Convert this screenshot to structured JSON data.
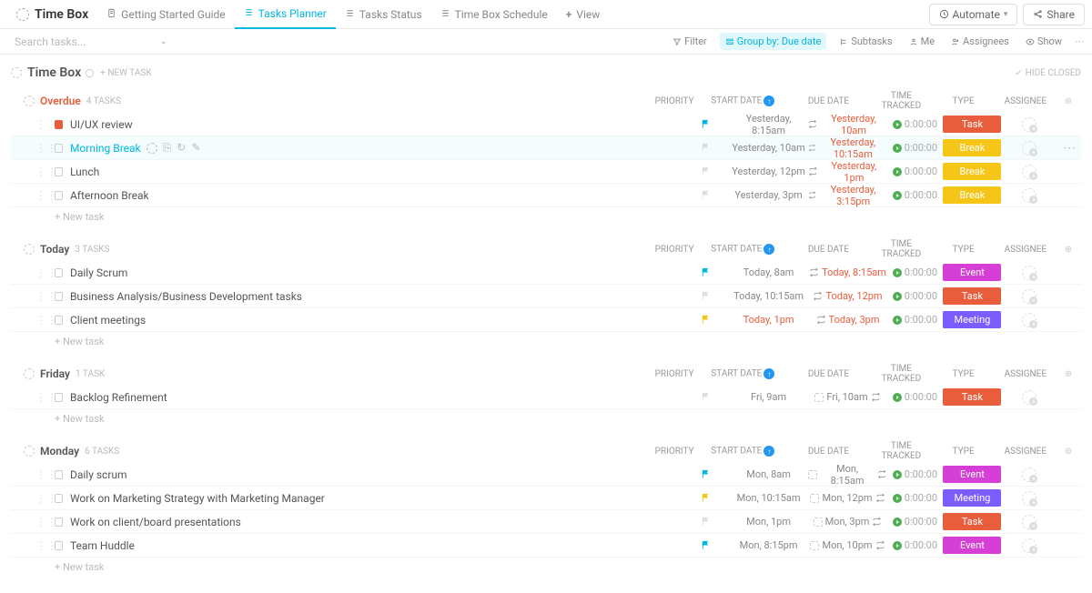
{
  "header": {
    "space_title": "Time Box",
    "tabs": [
      {
        "label": "Getting Started Guide",
        "icon": "doc"
      },
      {
        "label": "Tasks Planner",
        "icon": "list",
        "active": true
      },
      {
        "label": "Tasks Status",
        "icon": "list"
      },
      {
        "label": "Time Box Schedule",
        "icon": "list"
      },
      {
        "label": "View",
        "icon": "plus"
      }
    ],
    "automate": "Automate",
    "share": "Share"
  },
  "search": {
    "placeholder": "Search tasks..."
  },
  "filters": {
    "filter": "Filter",
    "group_by": "Group by: Due date",
    "subtasks": "Subtasks",
    "me": "Me",
    "assignees": "Assignees",
    "show": "Show"
  },
  "list": {
    "name": "Time Box",
    "new_task": "+ NEW TASK",
    "hide_closed": "HIDE CLOSED"
  },
  "cols": {
    "priority": "PRIORITY",
    "start": "START DATE",
    "due": "DUE DATE",
    "time": "TIME TRACKED",
    "type": "TYPE",
    "assignee": "ASSIGNEE"
  },
  "new_task_row": "+ New task",
  "type_colors": {
    "Task": "#e85d3c",
    "Break": "#f5c518",
    "Event": "#d63fd6",
    "Meeting": "#7b5cff"
  },
  "groups": [
    {
      "title": "Overdue",
      "count": "4 TASKS",
      "overdue": true,
      "tasks": [
        {
          "name": "UI/UX review",
          "cb": "orange",
          "flag": "#00b7e0",
          "start": "Yesterday, 8:15am",
          "due": "Yesterday, 10am",
          "due_red": true,
          "repeat": true,
          "time": "0:00:00",
          "type": "Task"
        },
        {
          "name": "Morning Break",
          "cb": "gray",
          "flag": "#ddd",
          "start": "Yesterday, 10am",
          "due": "Yesterday, 10:15am",
          "due_red": true,
          "repeat": true,
          "time": "0:00:00",
          "type": "Break",
          "active": true,
          "hover": true
        },
        {
          "name": "Lunch",
          "cb": "gray",
          "flag": "#ddd",
          "start": "Yesterday, 12pm",
          "due": "Yesterday, 1pm",
          "due_red": true,
          "repeat": true,
          "time": "0:00:00",
          "type": "Break"
        },
        {
          "name": "Afternoon Break",
          "cb": "gray",
          "flag": "#ddd",
          "start": "Yesterday, 3pm",
          "due": "Yesterday, 3:15pm",
          "due_red": true,
          "repeat": true,
          "time": "0:00:00",
          "type": "Break"
        }
      ]
    },
    {
      "title": "Today",
      "count": "3 TASKS",
      "tasks": [
        {
          "name": "Daily Scrum",
          "cb": "gray",
          "flag": "#00b7e0",
          "start": "Today, 8am",
          "due": "Today, 8:15am",
          "due_red": true,
          "repeat": true,
          "time": "0:00:00",
          "type": "Event"
        },
        {
          "name": "Business Analysis/Business Development tasks",
          "cb": "gray",
          "flag": "#ddd",
          "start": "Today, 10:15am",
          "due": "Today, 12pm",
          "due_red": true,
          "repeat": true,
          "time": "0:00:00",
          "type": "Task"
        },
        {
          "name": "Client meetings",
          "cb": "gray",
          "flag": "#f5c518",
          "start": "Today, 1pm",
          "start_orange": true,
          "due": "Today, 3pm",
          "due_red": true,
          "repeat": true,
          "time": "0:00:00",
          "type": "Meeting"
        }
      ]
    },
    {
      "title": "Friday",
      "count": "1 TASK",
      "tasks": [
        {
          "name": "Backlog Refinement",
          "cb": "gray",
          "flag": "#ddd",
          "start": "Fri, 9am",
          "due": "Fri, 10am",
          "ghost_cal": true,
          "repeat": true,
          "time": "0:00:00",
          "type": "Task"
        }
      ]
    },
    {
      "title": "Monday",
      "count": "6 TASKS",
      "tasks": [
        {
          "name": "Daily scrum",
          "cb": "gray",
          "flag": "#00b7e0",
          "start": "Mon, 8am",
          "due": "Mon, 8:15am",
          "ghost_cal": true,
          "repeat": true,
          "time": "0:00:00",
          "type": "Event"
        },
        {
          "name": "Work on Marketing Strategy with Marketing Manager",
          "cb": "gray",
          "flag": "#f5c518",
          "start": "Mon, 10:15am",
          "due": "Mon, 12pm",
          "ghost_cal": true,
          "repeat": true,
          "time": "0:00:00",
          "type": "Meeting"
        },
        {
          "name": "Work on client/board presentations",
          "cb": "gray",
          "flag": "#ddd",
          "start": "Mon, 1pm",
          "due": "Mon, 3pm",
          "ghost_cal": true,
          "repeat": true,
          "time": "0:00:00",
          "type": "Task"
        },
        {
          "name": "Team Huddle",
          "cb": "gray",
          "flag": "#00b7e0",
          "start": "Mon, 8:15pm",
          "due": "Mon, 10pm",
          "ghost_cal": true,
          "repeat": true,
          "time": "0:00:00",
          "type": "Event"
        }
      ]
    }
  ]
}
